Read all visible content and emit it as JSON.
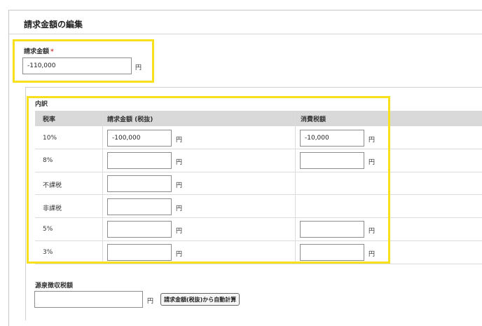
{
  "page": {
    "title": "請求金額の編集"
  },
  "invoice": {
    "label": "請求金額",
    "required_mark": "*",
    "value": "-110,000",
    "unit": "円"
  },
  "breakdown": {
    "label": "内訳",
    "headers": {
      "rate": "税率",
      "amount": "請求金額 (税抜)",
      "tax": "消費税額"
    },
    "rows": [
      {
        "rate": "10%",
        "amount": "-100,000",
        "tax": "-10,000",
        "has_tax": true
      },
      {
        "rate": "8%",
        "amount": "",
        "tax": "",
        "has_tax": true
      },
      {
        "rate": "不課税",
        "amount": "",
        "tax": "",
        "has_tax": false
      },
      {
        "rate": "非課税",
        "amount": "",
        "tax": "",
        "has_tax": false
      },
      {
        "rate": "5%",
        "amount": "",
        "tax": "",
        "has_tax": true
      },
      {
        "rate": "3%",
        "amount": "",
        "tax": "",
        "has_tax": true
      }
    ],
    "unit": "円"
  },
  "withholding": {
    "label": "源泉徴収税額",
    "value": "",
    "unit": "円",
    "auto_calc_button": "請求金額(税抜)から自動計算"
  },
  "colors": {
    "highlight": "#f7e11c",
    "required": "#d43b3b",
    "header_bg": "#d9d9d9"
  }
}
